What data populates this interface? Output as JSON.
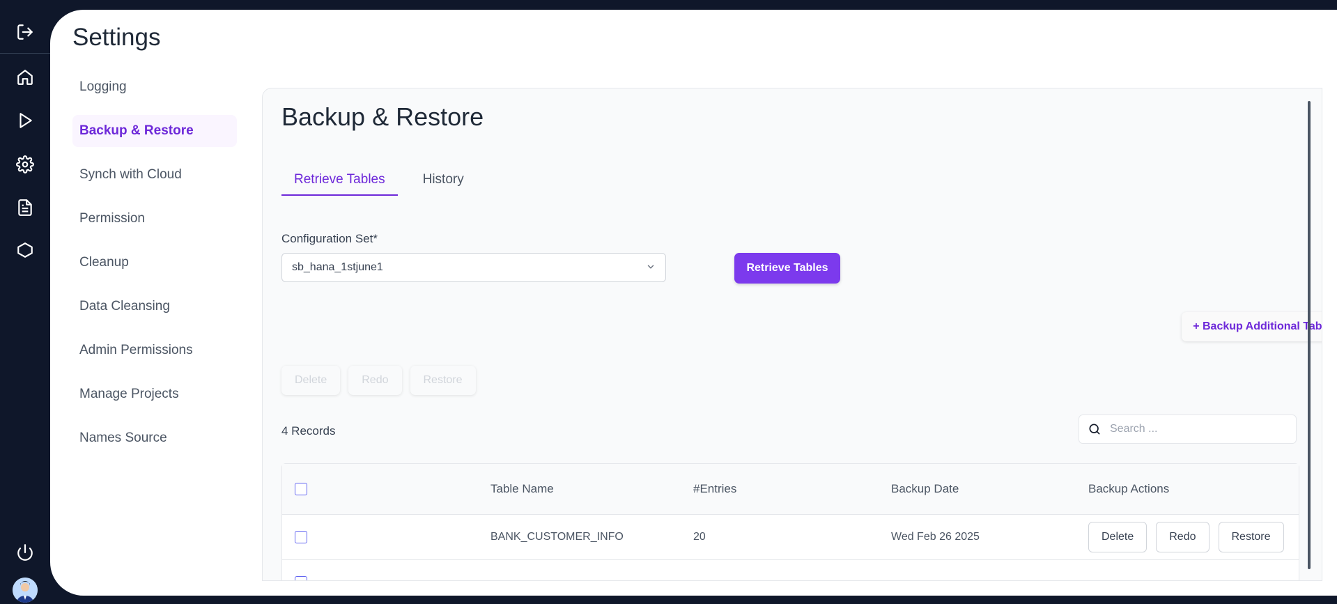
{
  "page_title": "Settings",
  "nav": {
    "items": [
      {
        "label": "Logging"
      },
      {
        "label": "Backup & Restore"
      },
      {
        "label": "Synch with Cloud"
      },
      {
        "label": "Permission"
      },
      {
        "label": "Cleanup"
      },
      {
        "label": "Data Cleansing"
      },
      {
        "label": "Admin Permissions"
      },
      {
        "label": "Manage Projects"
      },
      {
        "label": "Names Source"
      }
    ]
  },
  "card": {
    "title": "Backup & Restore",
    "tabs": [
      {
        "label": "Retrieve Tables"
      },
      {
        "label": "History"
      }
    ],
    "config_label": "Configuration Set*",
    "config_value": "sb_hana_1stjune1",
    "retrieve_button": "Retrieve Tables",
    "additional_button": "+ Backup Additional Tables",
    "bulk": {
      "delete": "Delete",
      "redo": "Redo",
      "restore": "Restore"
    },
    "records": "4 Records",
    "search_placeholder": "Search ...",
    "table": {
      "headers": [
        "Table Name",
        "#Entries",
        "Backup Date",
        "Backup Actions"
      ],
      "rows": [
        {
          "name": "BANK_CUSTOMER_INFO",
          "entries": "20",
          "date": "Wed Feb 26 2025",
          "actions": {
            "delete": "Delete",
            "redo": "Redo",
            "restore": "Restore"
          }
        }
      ]
    }
  },
  "colors": {
    "accent": "#7c3aed",
    "rail": "#0f172a"
  },
  "icons": [
    "logout-icon",
    "home-icon",
    "play-icon",
    "gear-icon",
    "document-icon",
    "hexagon-icon",
    "power-icon",
    "avatar"
  ]
}
